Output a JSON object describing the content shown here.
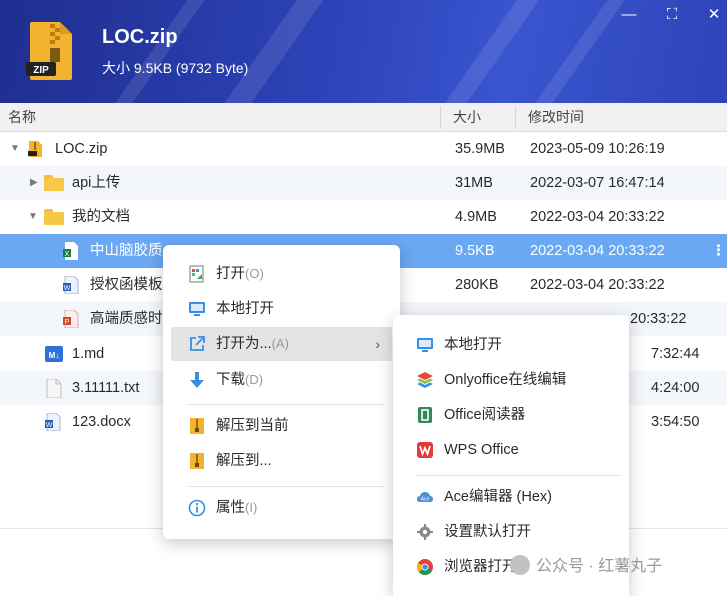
{
  "header": {
    "file_name": "LOC.zip",
    "size_info": "大小 9.5KB (9732 Byte)",
    "zip_badge": "ZIP",
    "minimize_glyph": "—",
    "maximize_glyph": "⛶",
    "close_glyph": "✕"
  },
  "columns": {
    "name": "名称",
    "size": "大小",
    "modified": "修改时间"
  },
  "rows": [
    {
      "name": "LOC.zip",
      "size": "35.9MB",
      "time": "2023-05-09 10:26:19",
      "icon": "zip-file-icon",
      "expand": "expanded"
    },
    {
      "name": "api上传",
      "size": "31MB",
      "time": "2022-03-07 16:47:14",
      "icon": "folder-icon",
      "expand": "collapsed"
    },
    {
      "name": "我的文档",
      "size": "4.9MB",
      "time": "2022-03-04 20:33:22",
      "icon": "folder-icon",
      "expand": "expanded"
    },
    {
      "name": "中山脑胶质",
      "size": "9.5KB",
      "time": "2022-03-04 20:33:22",
      "icon": "excel-file-icon",
      "selected": true
    },
    {
      "name": "授权函模板",
      "size": "280KB",
      "time": "2022-03-04 20:33:22",
      "icon": "word-file-icon"
    },
    {
      "name": "高端质感时",
      "size": "",
      "time": "20:33:22",
      "icon": "ppt-file-icon"
    },
    {
      "name": "1.md",
      "size": "",
      "time": "7:32:44",
      "icon": "markdown-file-icon"
    },
    {
      "name": "3.11111.txt",
      "size": "",
      "time": "4:24:00",
      "icon": "text-file-icon"
    },
    {
      "name": "123.docx",
      "size": "",
      "time": "3:54:50",
      "icon": "word-file-icon"
    }
  ],
  "row_more_glyph": "⋮",
  "context_menu": {
    "items": [
      {
        "label": "打开",
        "key": "(O)",
        "icon": "open-icon"
      },
      {
        "label": "本地打开",
        "key": "",
        "icon": "monitor-icon"
      },
      {
        "label": "打开为...",
        "key": "(A)",
        "icon": "open-external-icon",
        "has_submenu": true
      },
      {
        "label": "下载",
        "key": "(D)",
        "icon": "download-icon"
      },
      {
        "label": "解压到当前",
        "key": "",
        "icon": "extract-icon"
      },
      {
        "label": "解压到...",
        "key": "",
        "icon": "extract-to-icon"
      },
      {
        "label": "属性",
        "key": "(I)",
        "icon": "info-icon"
      }
    ],
    "chevron": "›"
  },
  "submenu": {
    "items": [
      {
        "label": "本地打开",
        "icon": "monitor-icon"
      },
      {
        "label": "Onlyoffice在线编辑",
        "icon": "onlyoffice-icon"
      },
      {
        "label": "Office阅读器",
        "icon": "office-icon"
      },
      {
        "label": "WPS Office",
        "icon": "wps-icon"
      },
      {
        "label": "Ace编辑器 (Hex)",
        "icon": "ace-editor-icon"
      },
      {
        "label": "设置默认打开",
        "icon": "gear-icon"
      },
      {
        "label": "浏览器打开",
        "icon": "chrome-icon"
      }
    ]
  },
  "watermark": "公众号 · 红薯丸子",
  "colors": {
    "header_bg": "#2c43b8",
    "selected_row": "#6aa8f3",
    "alt_row": "#f3f6fb",
    "menu_hover": "#e4e4e4"
  }
}
